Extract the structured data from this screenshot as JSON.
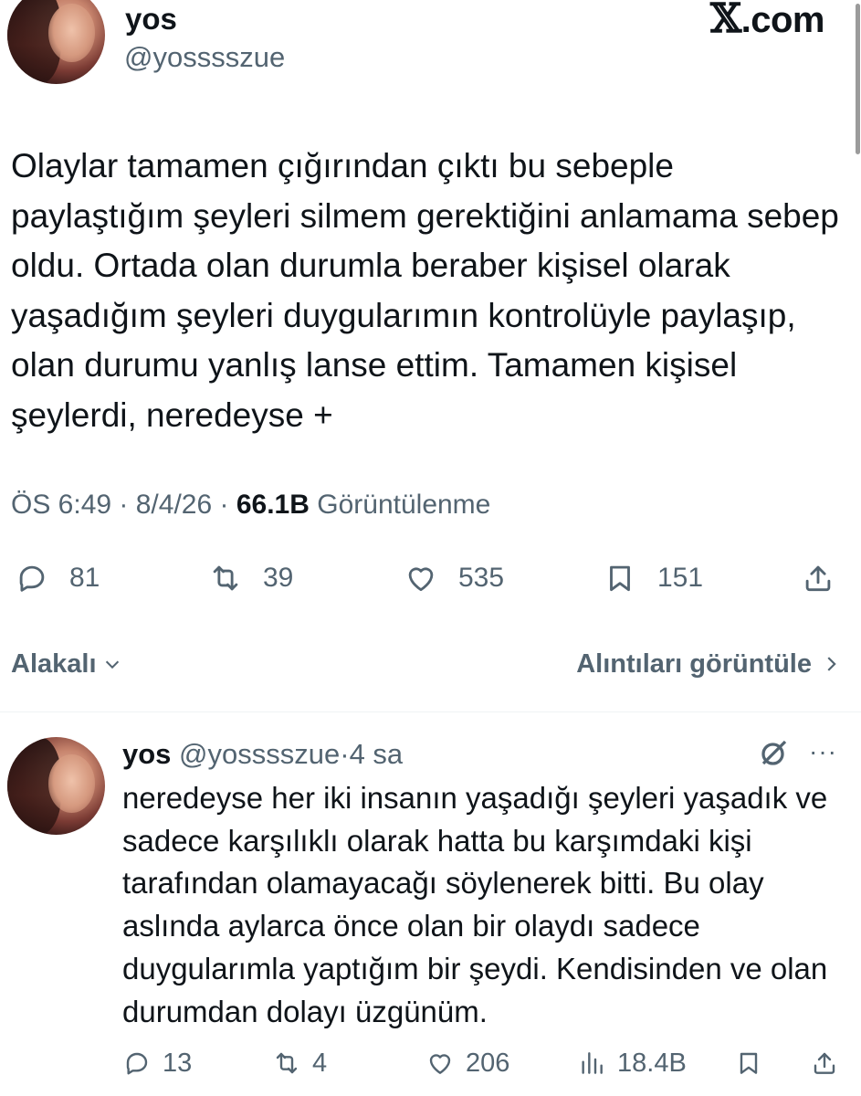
{
  "brand": {
    "label": ".com"
  },
  "tweet": {
    "display_name": "yos",
    "handle": "@yosssszue",
    "text": "Olaylar tamamen çığırından çıktı bu sebeple paylaştığım şeyleri silmem gerektiğini anlamama sebep oldu. Ortada olan durumla beraber kişisel olarak yaşadığım şeyleri duygularımın kontrolüyle paylaşıp, olan durumu yanlış lanse ettim. Tamamen kişisel şeylerdi, neredeyse +",
    "time": "ÖS 6:49",
    "date": "8/4/26",
    "views_count": "66.1B",
    "views_label": "Görüntülenme",
    "replies": "81",
    "reposts": "39",
    "likes": "535",
    "bookmarks": "151"
  },
  "filters": {
    "relevance_label": "Alakalı",
    "quotes_label": "Alıntıları görüntüle"
  },
  "reply": {
    "display_name": "yos",
    "handle": "@yosssszue",
    "separator": "·",
    "time_ago": "4 sa",
    "more": "···",
    "text": "neredeyse her iki insanın yaşadığı şeyleri yaşadık ve sadece karşılıklı olarak hatta bu karşımdaki kişi tarafından olamayacağı söylenerek bitti. Bu olay aslında aylarca önce olan bir olaydı sadece duygularımla yaptığım bir şeydi. Kendisinden ve olan durumdan dolayı üzgünüm.",
    "replies": "13",
    "reposts": "4",
    "likes": "206",
    "views": "18.4B"
  },
  "icons": {
    "reply": "speech-bubble-icon",
    "repost": "repost-arrows-icon",
    "like": "heart-icon",
    "bookmark": "bookmark-icon",
    "share": "share-upload-icon",
    "views": "bar-chart-icon",
    "grok": "slashed-circle-icon",
    "chevron_down": "chevron-down-icon",
    "chevron_right": "chevron-right-icon"
  },
  "colors": {
    "text_primary": "#0f1419",
    "text_secondary": "#536471",
    "divider": "#eff3f4"
  }
}
